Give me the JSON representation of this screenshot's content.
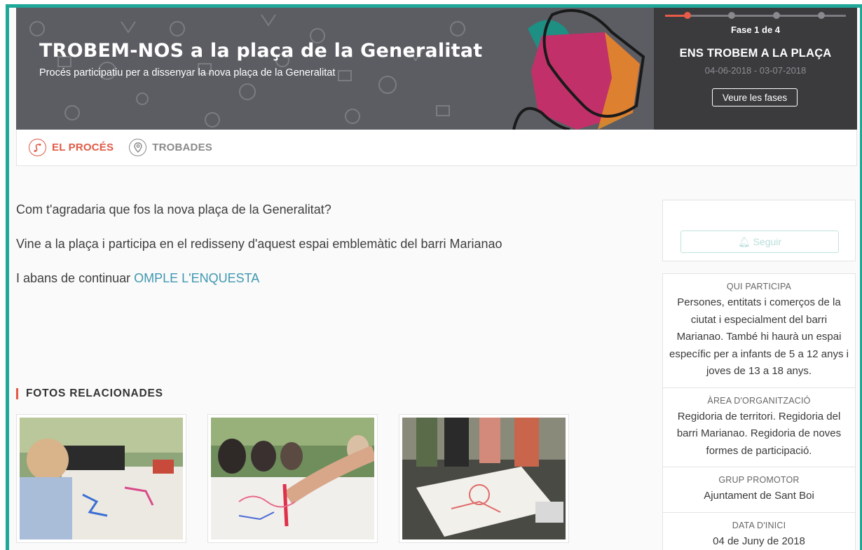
{
  "hero": {
    "title": "TROBEM-NOS a la plaça de la Generalitat",
    "subtitle": "Procés participatiu per a dissenyar la nova plaça de la Generalitat"
  },
  "phase": {
    "counter": "Fase 1 de 4",
    "current": 1,
    "total": 4,
    "name": "ENS TROBEM A LA PLAÇA",
    "dates": "04-06-2018 - 03-07-2018",
    "button": "Veure les fases"
  },
  "tabs": [
    {
      "label": "EL PROCÉS",
      "icon": "process-icon",
      "active": true
    },
    {
      "label": "TROBADES",
      "icon": "location-pin-icon",
      "active": false
    }
  ],
  "content": {
    "p1": "Com t'agradaria que fos la nova plaça de la Generalitat?",
    "p2": "Vine a la plaça i participa en el redisseny d'aquest espai emblemàtic del barri Marianao",
    "p3_prefix": "I abans de continuar ",
    "p3_link": "OMPLE L'ENQUESTA"
  },
  "photos": {
    "title": "FOTOS RELACIONADES"
  },
  "sidebar": {
    "follow": "Seguir",
    "info": [
      {
        "label": "QUI PARTICIPA",
        "value": "Persones, entitats i comerços de la ciutat i especialment del barri Marianao. També hi haurà un espai específic per a infants de 5 a 12 anys i joves de 13 a 18 anys."
      },
      {
        "label": "ÀREA D'ORGANITZACIÓ",
        "value": "Regidoria de territori. Regidoria del barri Marianao. Regidoria de noves formes de participació."
      },
      {
        "label": "GRUP PROMOTOR",
        "value": "Ajuntament de Sant Boi"
      },
      {
        "label": "DATA D'INICI",
        "value": "04 de Juny de 2018"
      }
    ]
  },
  "colors": {
    "accent": "#e05a45",
    "link": "#3f98b0",
    "frame": "#1fa89a",
    "phase_bg": "#3b3b3e"
  }
}
